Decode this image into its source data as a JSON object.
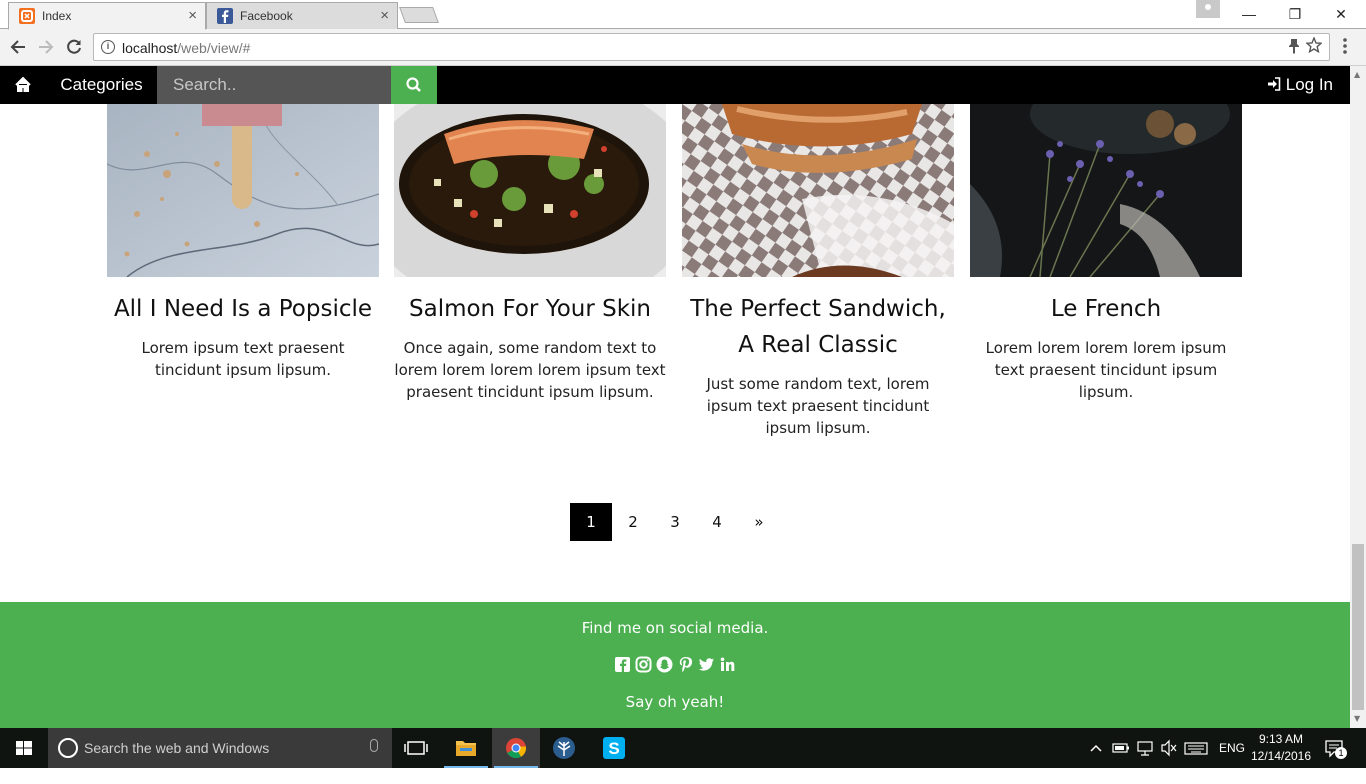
{
  "browser": {
    "tabs": [
      {
        "title": "Index",
        "active": true
      },
      {
        "title": "Facebook",
        "active": false
      }
    ],
    "tab_close": "×",
    "url_host": "localhost",
    "url_path": "/web/view/#",
    "win_minimize": "—",
    "win_restore": "❐",
    "win_close": "✕"
  },
  "nav": {
    "categories": "Categories",
    "search_placeholder": "Search..",
    "login": "Log In"
  },
  "cards": [
    {
      "title": "All I Need Is a Popsicle",
      "text": "Lorem ipsum text praesent tincidunt ipsum lipsum."
    },
    {
      "title": "Salmon For Your Skin",
      "text": "Once again, some random text to lorem lorem lorem lorem ipsum text praesent tincidunt ipsum lipsum."
    },
    {
      "title": "The Perfect Sandwich, A Real Classic",
      "text": "Just some random text, lorem ipsum text praesent tincidunt ipsum lipsum."
    },
    {
      "title": "Le French",
      "text": "Lorem lorem lorem lorem ipsum text praesent tincidunt ipsum lipsum."
    }
  ],
  "pagination": {
    "pages": [
      "1",
      "2",
      "3",
      "4"
    ],
    "next": "»",
    "current": "1"
  },
  "footer": {
    "line1": "Find me on social media.",
    "line2": "Say oh yeah!",
    "social_icons": [
      "facebook-icon",
      "instagram-icon",
      "snapchat-icon",
      "pinterest-icon",
      "twitter-icon",
      "linkedin-icon"
    ]
  },
  "taskbar": {
    "search_text": "Search the web and Windows",
    "language": "ENG",
    "time": "9:13 AM",
    "date": "12/14/2016",
    "notification_count": "1"
  },
  "colors": {
    "accent_green": "#4caf50",
    "nav_black": "#000000",
    "search_grey": "#555555"
  }
}
